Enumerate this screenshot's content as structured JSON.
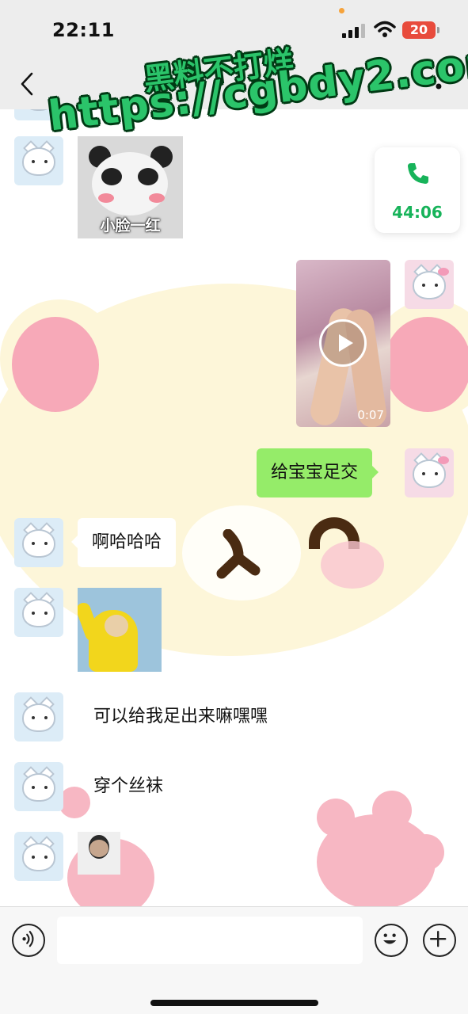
{
  "status_bar": {
    "time": "22:11",
    "battery": "20"
  },
  "nav": {
    "back_icon": "chevron-left-icon",
    "more_icon": "more-icon"
  },
  "watermark": {
    "line1": "黑料不打烊",
    "line2": "https://cgbdy2.com"
  },
  "call_card": {
    "duration": "44:06",
    "icon": "phone-icon",
    "color": "#17b35a"
  },
  "messages": [
    {
      "side": "left",
      "type": "sticker",
      "caption": "小脸一红"
    },
    {
      "side": "right",
      "type": "video",
      "duration": "0:07"
    },
    {
      "side": "right",
      "type": "text",
      "text": "给宝宝足交"
    },
    {
      "side": "left",
      "type": "text",
      "text": "啊哈哈哈"
    },
    {
      "side": "left",
      "type": "sticker",
      "caption": ""
    },
    {
      "side": "left",
      "type": "text",
      "text": "可以给我足出来嘛嘿嘿"
    },
    {
      "side": "left",
      "type": "text",
      "text": "穿个丝袜"
    },
    {
      "side": "left",
      "type": "sticker",
      "caption": ""
    }
  ],
  "input_bar": {
    "voice_icon": "voice-icon",
    "emoji_icon": "emoji-icon",
    "plus_icon": "plus-icon",
    "placeholder": ""
  },
  "colors": {
    "sent_bubble": "#95ec69",
    "received_bubble": "#ffffff",
    "background": "#ededed"
  }
}
